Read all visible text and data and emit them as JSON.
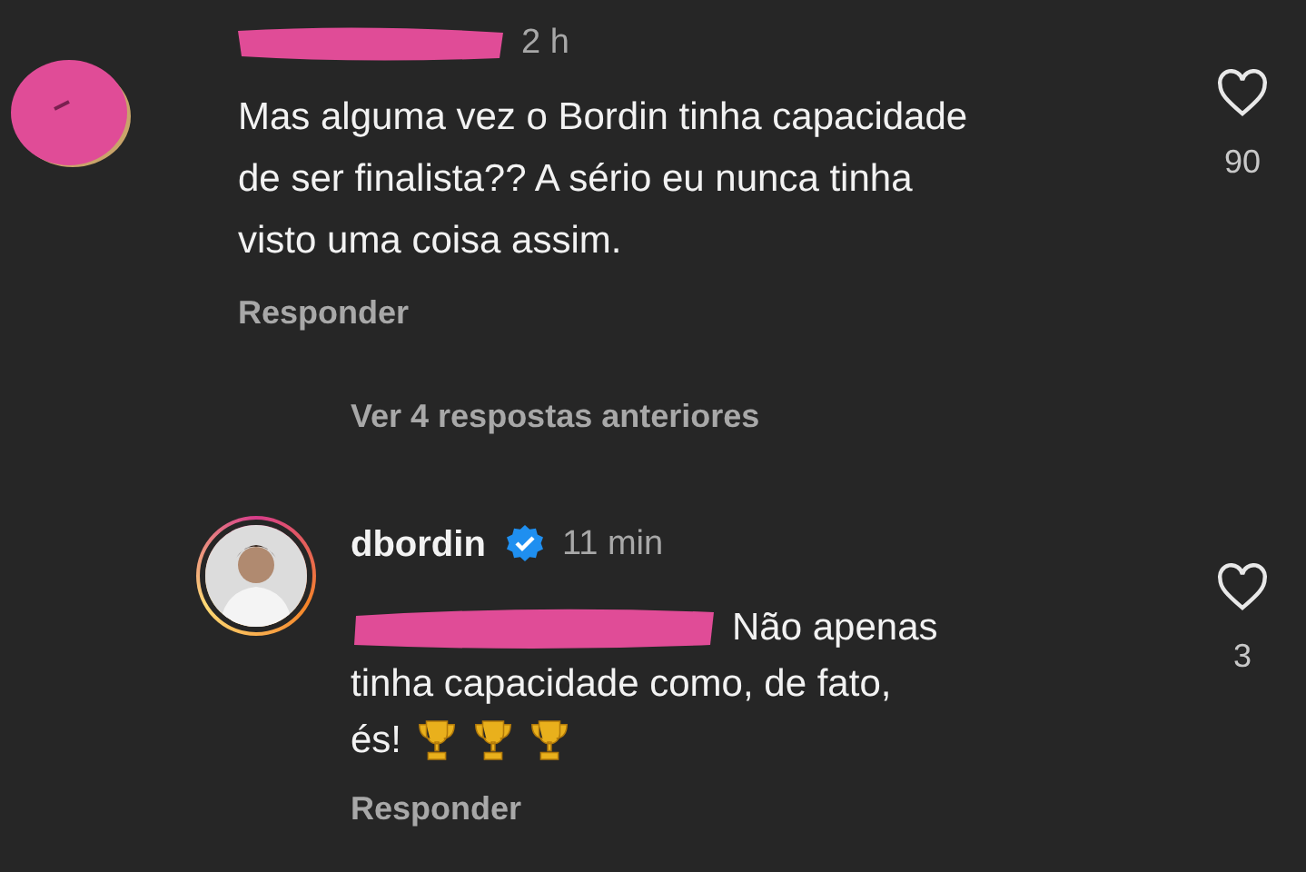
{
  "comment": {
    "time": "2 h",
    "text": "Mas alguma vez o Bordin tinha capacidade de ser finalista?? A sério eu nunca tinha visto uma coisa assim.",
    "reply_label": "Responder",
    "like_count": "90"
  },
  "view_replies": "Ver 4 respostas anteriores",
  "reply": {
    "username": "dbordin",
    "verified": true,
    "time": "11 min",
    "text_lines": [
      "Não apenas",
      "tinha capacidade como, de fato,",
      "és!"
    ],
    "emojis": [
      {
        "kind": "trophy"
      },
      {
        "kind": "trophy"
      },
      {
        "kind": "trophy"
      }
    ],
    "reply_label": "Responder",
    "like_count": "3"
  }
}
